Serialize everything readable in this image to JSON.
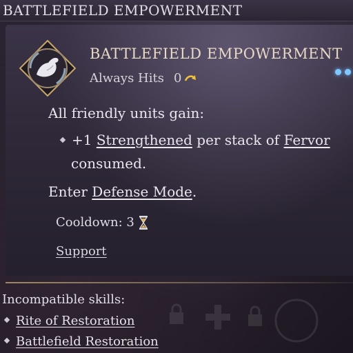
{
  "header": {
    "title": "BATTLEFIELD EMPOWERMENT"
  },
  "skill": {
    "title": "BATTLEFIELD EMPOWERMENT",
    "icon": "flexed-arm-icon",
    "hit_type": "Always Hits",
    "cost": "0",
    "cost_icon": "curved-arrow-icon"
  },
  "description": {
    "line1": "All friendly units gain:",
    "bullet_prefix": "+1",
    "bullet_link1": "Strengthened",
    "bullet_mid": "per stack of",
    "bullet_link2": "Fervor",
    "bullet_suffix": "consumed.",
    "enter_prefix": "Enter",
    "enter_link": "Defense Mode",
    "enter_suffix": "."
  },
  "cooldown": {
    "label": "Cooldown: 3",
    "icon": "hourglass-icon"
  },
  "category": "Support",
  "incompatible": {
    "label": "Incompatible skills:",
    "items": [
      "Rite of Restoration",
      "Battlefield Restoration"
    ]
  },
  "colors": {
    "accent_gold": "#c9a86a",
    "indicator_blue": "#7fc8ff"
  }
}
